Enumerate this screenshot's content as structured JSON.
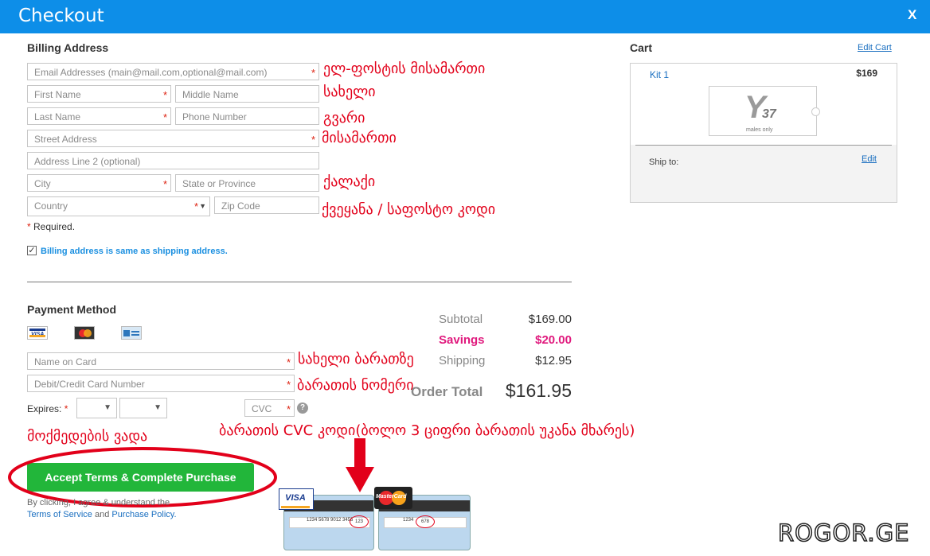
{
  "header": {
    "title": "Checkout",
    "close_label": "X"
  },
  "billing": {
    "title": "Billing Address",
    "fields": {
      "email": "Email Addresses (main@mail.com,optional@mail.com)",
      "first_name": "First Name",
      "middle_name": "Middle Name",
      "last_name": "Last Name",
      "phone": "Phone Number",
      "street": "Street Address",
      "address2": "Address Line 2 (optional)",
      "city": "City",
      "state": "State or Province",
      "country": "Country",
      "zip": "Zip Code"
    },
    "required_mark": "*",
    "required_note": "Required.",
    "same_as_shipping": "Billing address is same as shipping address.",
    "same_as_shipping_checked": true
  },
  "annotations": {
    "email": "ელ-ფოსტის მისამართი",
    "name": "სახელი",
    "surname": "გვარი",
    "address": "მისამართი",
    "city": "ქალაქი",
    "country_zip": "ქვეყანა / საფოსტო კოდი",
    "card_name": "სახელი ბარათზე",
    "card_number": "ბარათის ნომერი",
    "expiry": "მოქმედების ვადა",
    "cvc": "ბარათის CVC კოდი(ბოლო 3 ციფრი ბარათის უკანა მხარეს)"
  },
  "payment": {
    "title": "Payment Method",
    "card_icons": [
      "visa-icon",
      "mastercard-icon",
      "amex-icon"
    ],
    "name_on_card": "Name on Card",
    "card_number": "Debit/Credit Card Number",
    "expires_label": "Expires:",
    "cvc_placeholder": "CVC",
    "help_icon": "?",
    "button_label": "Accept Terms & Complete Purchase",
    "terms_prefix": "By clicking, I agree & understand the",
    "terms_link": "Terms of Service",
    "terms_and": "and",
    "policy_link": "Purchase Policy."
  },
  "summary": {
    "subtotal_label": "Subtotal",
    "subtotal_value": "$169.00",
    "savings_label": "Savings",
    "savings_value": "$20.00",
    "shipping_label": "Shipping",
    "shipping_value": "$12.95",
    "total_label": "Order Total",
    "total_value": "$161.95"
  },
  "cards_illustration": {
    "visa_label": "VISA",
    "visa_number": "1234 5678 9012 3456",
    "visa_cvc": "123",
    "mc_label": "MasterCard",
    "mc_number": "1234",
    "mc_cvc": "678"
  },
  "cart": {
    "title": "Cart",
    "edit_cart": "Edit Cart",
    "item_name": "Kit 1",
    "item_price": "$169",
    "logo_text": "37",
    "logo_sub": "males only",
    "ship_to": "Ship to:",
    "edit": "Edit"
  },
  "watermark": "ROGOR.GE",
  "colors": {
    "header": "#0d8ee8",
    "annotation": "#e2001a",
    "button": "#22b63a",
    "savings": "#e0197d",
    "link": "#1a8fe0"
  }
}
